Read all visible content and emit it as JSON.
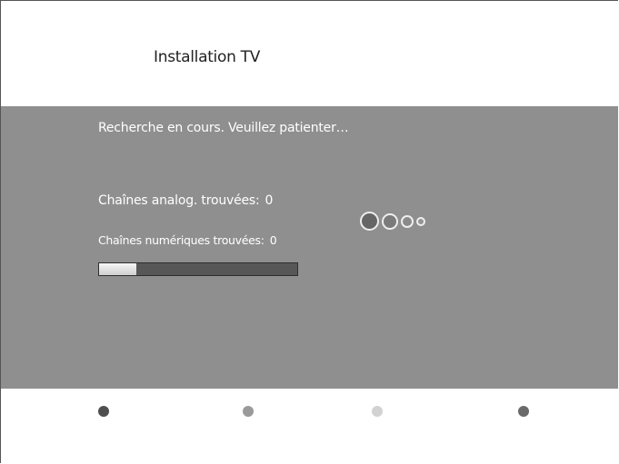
{
  "header": {
    "title": "Installation TV"
  },
  "panel": {
    "status_text": "Recherche en cours. Veuillez patienter…",
    "analog": {
      "label": "Chaînes analog. trouvées:",
      "count": "0"
    },
    "digital": {
      "label": "Chaînes numériques trouvées:",
      "count": "0"
    },
    "progress": {
      "fraction": 0.19
    }
  },
  "color_keys": [
    {
      "name": "red-key",
      "shade": "#4f4f4f"
    },
    {
      "name": "green-key",
      "shade": "#9a9a9a"
    },
    {
      "name": "yellow-key",
      "shade": "#d2d2d2"
    },
    {
      "name": "blue-key",
      "shade": "#6a6a6a"
    }
  ]
}
